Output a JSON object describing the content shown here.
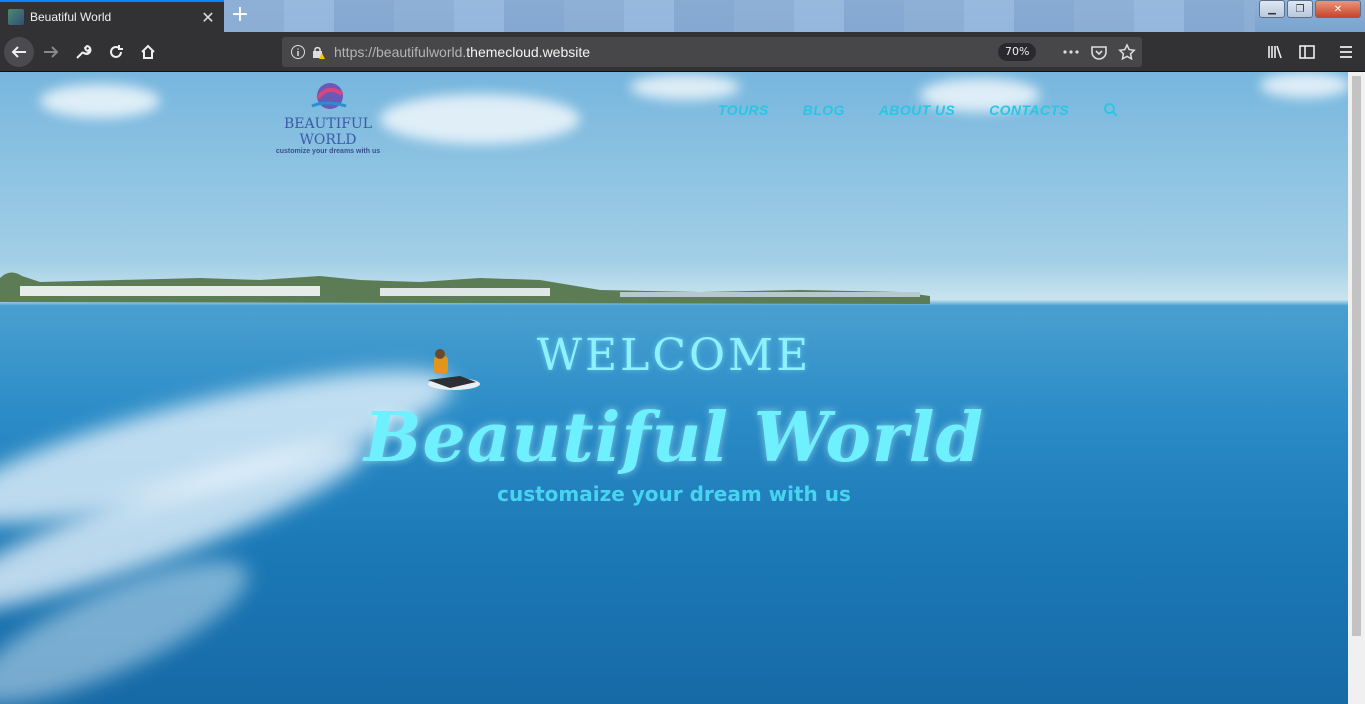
{
  "browser": {
    "tab_title": "Beuatiful World",
    "url_prefix": "https://beautifulworld.",
    "url_domain": "themecloud.website",
    "zoom": "70%"
  },
  "site": {
    "logo_name": "BEAUTIFUL WORLD",
    "logo_tagline": "customize your dreams with us",
    "menu": [
      "TOURS",
      "BLOG",
      "ABOUT US",
      "CONTACTS"
    ],
    "hero_welcome": "WELCOME",
    "hero_title": "Beautiful World",
    "hero_tagline": "customaize your dream with us"
  },
  "icons": {
    "tab": [
      "favicon",
      "close-icon",
      "plus-icon"
    ],
    "nav": [
      "back-icon",
      "forward-icon",
      "wrench-icon",
      "reload-icon",
      "home-icon",
      "info-icon",
      "lock-warning-icon",
      "more-icon",
      "pocket-icon",
      "star-icon",
      "library-icon",
      "sidebar-icon",
      "hamburger-icon"
    ],
    "site": [
      "search-icon"
    ]
  },
  "colors": {
    "accent": "#27c7e3",
    "tab_indicator": "#0a84ff",
    "logo": "#3e5aa6"
  }
}
